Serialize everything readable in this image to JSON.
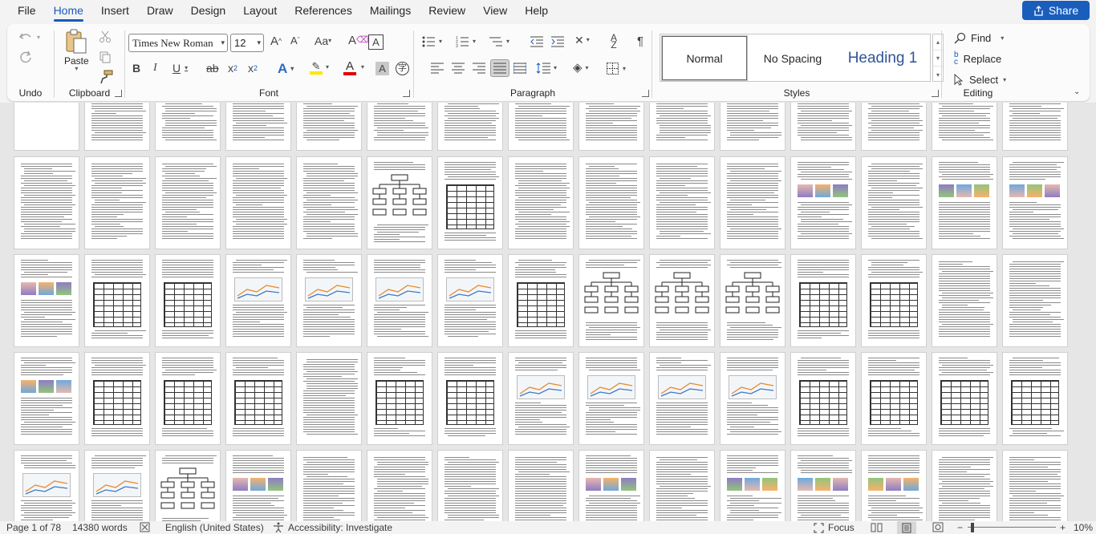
{
  "menu": {
    "tabs": [
      "File",
      "Home",
      "Insert",
      "Draw",
      "Design",
      "Layout",
      "References",
      "Mailings",
      "Review",
      "View",
      "Help"
    ],
    "active": "Home",
    "share_label": "Share"
  },
  "ribbon": {
    "undo": {
      "label": "Undo"
    },
    "clipboard": {
      "label": "Clipboard",
      "paste_label": "Paste"
    },
    "font": {
      "label": "Font",
      "font_name": "Times New Roman",
      "font_size": "12"
    },
    "paragraph": {
      "label": "Paragraph"
    },
    "styles": {
      "label": "Styles",
      "items": [
        "Normal",
        "No Spacing",
        "Heading 1"
      ]
    },
    "editing": {
      "label": "Editing",
      "find_label": "Find",
      "replace_label": "Replace",
      "select_label": "Select"
    }
  },
  "status": {
    "page": "Page 1 of 78",
    "words": "14380 words",
    "language": "English (United States)",
    "accessibility": "Accessibility: Investigate",
    "focus": "Focus",
    "zoom": "10%"
  },
  "colors": {
    "accent": "#185abd",
    "share_bg": "#1a5ebd",
    "highlight": "#ffe600",
    "font_color": "#e00000",
    "heading": "#2f5597"
  }
}
